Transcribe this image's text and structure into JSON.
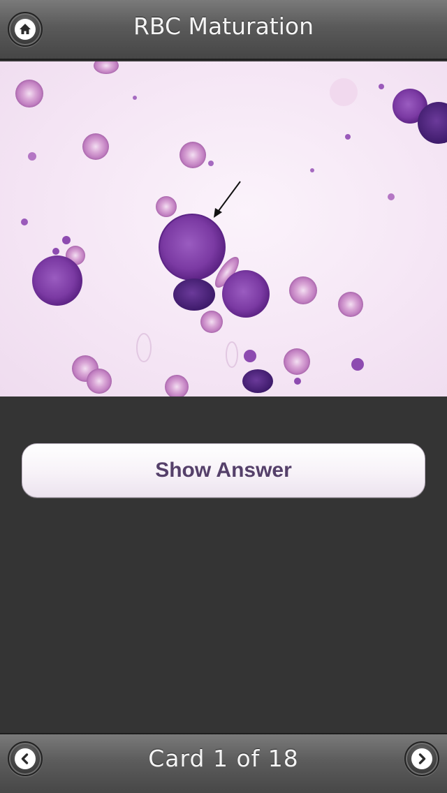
{
  "header": {
    "title": "RBC Maturation",
    "home_icon": "home-icon"
  },
  "card": {
    "image_icon": "blood-smear-micrograph",
    "show_answer_label": "Show Answer"
  },
  "footer": {
    "counter_text": "Card 1 of 18",
    "prev_icon": "chevron-left-icon",
    "next_icon": "chevron-right-icon"
  },
  "colors": {
    "background": "#343434",
    "bar": "#5a5a5a",
    "button_text": "#55406a",
    "smear_background": "#f5e6f5",
    "cell_nucleus": "#7a3a9e",
    "rbc": "#c98bc7"
  }
}
